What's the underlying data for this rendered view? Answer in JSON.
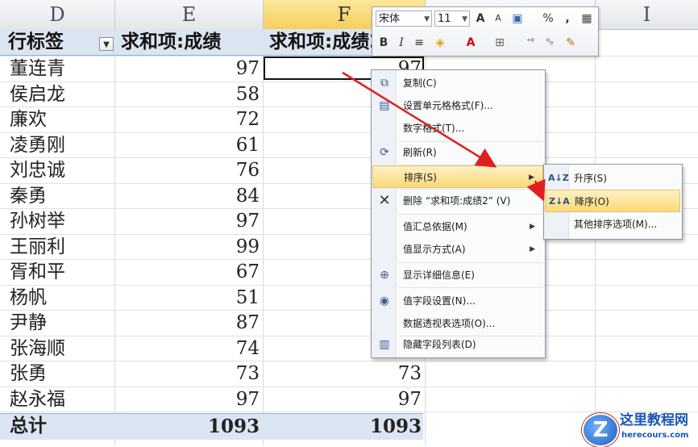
{
  "columns": [
    "D",
    "E",
    "F",
    "I"
  ],
  "pivot": {
    "header_row_label": "行标签",
    "header_sum1": "求和项:成绩",
    "header_sum2": "求和项:成绩2",
    "rows": [
      {
        "name": "董连青",
        "v1": "97",
        "v2": "97"
      },
      {
        "name": "侯启龙",
        "v1": "58",
        "v2": ""
      },
      {
        "name": "廉欢",
        "v1": "72",
        "v2": ""
      },
      {
        "name": "凌勇刚",
        "v1": "61",
        "v2": ""
      },
      {
        "name": "刘忠诚",
        "v1": "76",
        "v2": ""
      },
      {
        "name": "秦勇",
        "v1": "84",
        "v2": ""
      },
      {
        "name": "孙树举",
        "v1": "97",
        "v2": ""
      },
      {
        "name": "王丽利",
        "v1": "99",
        "v2": ""
      },
      {
        "name": "胥和平",
        "v1": "67",
        "v2": ""
      },
      {
        "name": "杨帆",
        "v1": "51",
        "v2": ""
      },
      {
        "name": "尹静",
        "v1": "87",
        "v2": ""
      },
      {
        "name": "张海顺",
        "v1": "74",
        "v2": ""
      },
      {
        "name": "张勇",
        "v1": "73",
        "v2": "73"
      },
      {
        "name": "赵永福",
        "v1": "97",
        "v2": "97"
      }
    ],
    "total_label": "总计",
    "total_v1": "1093",
    "total_v2": "1093"
  },
  "mini_toolbar": {
    "font_name": "宋体",
    "font_size": "11",
    "bold": "B",
    "italic": "I",
    "grow": "A",
    "shrink": "A",
    "percent": "%",
    "comma": ","
  },
  "context_menu": {
    "copy": "复制(C)",
    "format_cells": "设置单元格格式(F)...",
    "number_format": "数字格式(T)...",
    "refresh": "刷新(R)",
    "sort": "排序(S)",
    "delete": "删除 “求和项:成绩2” (V)",
    "summarize_by": "值汇总依据(M)",
    "show_values_as": "值显示方式(A)",
    "show_details": "显示详细信息(E)",
    "field_settings": "值字段设置(N)...",
    "pivot_options": "数据透视表选项(O)...",
    "hide_field_list": "隐藏字段列表(D)"
  },
  "sort_submenu": {
    "ascending": "升序(S)",
    "descending": "降序(O)",
    "more_options": "其他排序选项(M)..."
  },
  "watermark": {
    "title": "这里教程网",
    "url": "herecours.com"
  }
}
